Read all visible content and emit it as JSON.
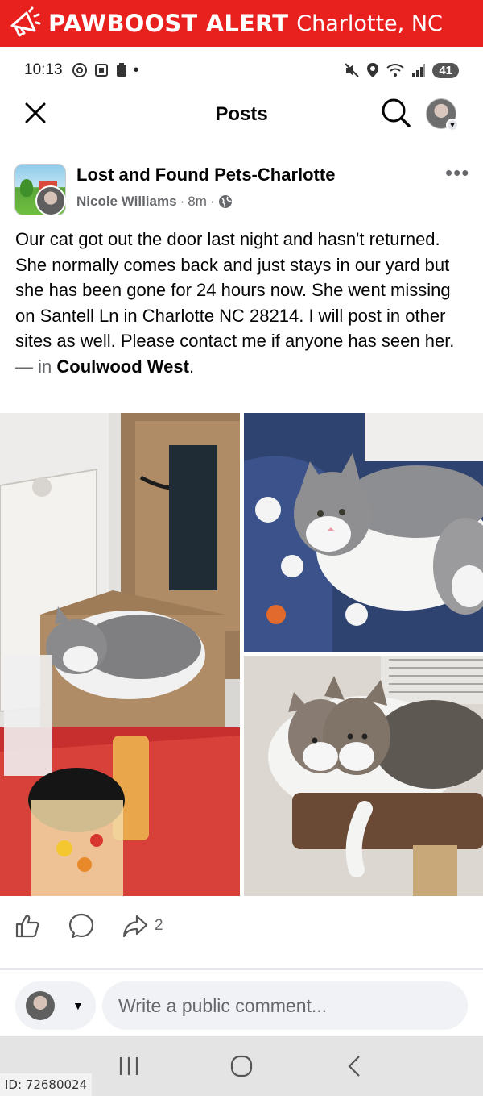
{
  "banner": {
    "brand": "PAWBOOST ALERT",
    "city": "Charlotte, NC",
    "icon": "megaphone-icon",
    "color": "#e8211f"
  },
  "status_bar": {
    "time": "10:13",
    "battery": "41"
  },
  "nav": {
    "title": "Posts"
  },
  "post": {
    "group": "Lost and Found Pets-Charlotte",
    "author": "Nicole Williams",
    "time_ago": "8m",
    "body": "Our cat got out the door last night and hasn't returned. She normally comes back and just stays in our yard but she has been gone for 24 hours now. She went missing on Santell Ln in Charlotte NC 28214. I will post in other sites as well. Please contact me if anyone has seen her.",
    "separator": "— in",
    "location": "Coulwood West",
    "location_suffix": ".",
    "share_count": "2"
  },
  "comment": {
    "placeholder": "Write a public comment..."
  },
  "watermark": {
    "id": "ID: 72680024"
  }
}
